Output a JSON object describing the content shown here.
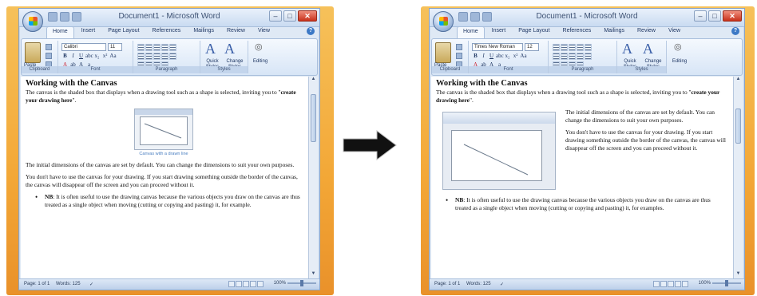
{
  "window": {
    "title": "Document1 - Microsoft Word",
    "tabs": [
      "Home",
      "Insert",
      "Page Layout",
      "References",
      "Mailings",
      "Review",
      "View"
    ],
    "active_tab": "Home"
  },
  "ribbon_left": {
    "paste_label": "Paste",
    "font_name": "Calibri",
    "font_size": "11",
    "styles_quick": "Quick Styles",
    "styles_change": "Change Styles",
    "editing": "Editing",
    "groups": [
      "Clipboard",
      "Font",
      "Paragraph",
      "Styles"
    ]
  },
  "ribbon_right": {
    "paste_label": "Paste",
    "font_name": "Times New Roman",
    "font_size": "12",
    "styles_quick": "Quick Styles",
    "styles_change": "Change Styles",
    "editing": "Editing",
    "groups": [
      "Clipboard",
      "Font",
      "Paragraph",
      "Styles"
    ]
  },
  "doc_left": {
    "heading": "Working with the Canvas",
    "intro_a": "The canvas is the shaded box that displays when a drawing tool such as a shape is selected, inviting you to \"",
    "intro_bold": "create your drawing here",
    "intro_b": "\".",
    "caption": "Canvas with a drawn line",
    "para1": "The initial dimensions of the canvas are set by default. You can change the dimensions to suit your own purposes.",
    "para2": "You don't have to use the canvas for your drawing. If you start drawing something outside the border of the canvas, the canvas will disappear off the screen and you can proceed without it.",
    "nb_label": "NB",
    "nb_text": ": It is often useful to use the drawing canvas because the various objects you draw on the canvas are thus treated as a single object when moving (cutting or copying and pasting) it, for example."
  },
  "doc_right": {
    "heading": "Working with the Canvas",
    "intro_a": "The canvas is the shaded box that displays when a drawing tool such as a shape is selected, inviting you to \"",
    "intro_bold": "create your drawing here",
    "intro_b": "\".",
    "para1": "The initial dimensions of the canvas are set by default. You can change the dimensions to suit your own purposes.",
    "para2": "You don't have to use the canvas for your drawing. If you start drawing something outside the border of the canvas, the canvas will disappear off the screen and you can proceed without it.",
    "nb_label": "NB",
    "nb_text": ": It is often useful to use the drawing canvas because the various objects you draw on the canvas are thus treated as a single object when moving (cutting or copying and pasting) it, for examples."
  },
  "status_left": {
    "page": "Page: 1 of 1",
    "words": "Words: 125",
    "zoom": "100%"
  },
  "status_right": {
    "page": "Page: 1 of 1",
    "words": "Words: 125",
    "zoom": "100%"
  },
  "colors": {
    "desktop": "#f3a736",
    "window": "#dfe9f5",
    "accent": "#3a5fa8",
    "close": "#c8321c"
  }
}
